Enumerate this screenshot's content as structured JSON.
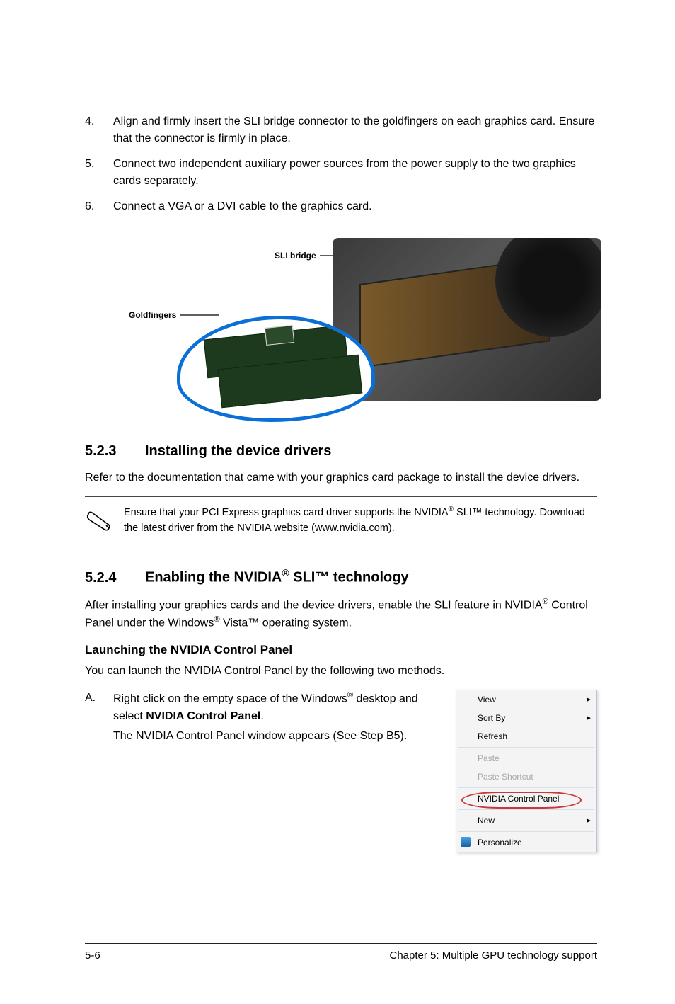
{
  "steps": {
    "s4": {
      "num": "4.",
      "text": "Align and firmly insert the SLI bridge connector to the goldfingers on each graphics card. Ensure that the connector is firmly in place."
    },
    "s5": {
      "num": "5.",
      "text": "Connect two independent auxiliary power sources from the power supply to the two graphics cards separately."
    },
    "s6": {
      "num": "6.",
      "text": "Connect a VGA or a DVI cable to the graphics card."
    }
  },
  "figure": {
    "label_sli": "SLI bridge",
    "label_gold": "Goldfingers"
  },
  "section523": {
    "num": "5.2.3",
    "title": "Installing the device drivers",
    "body": "Refer to the documentation that came with your graphics card package to install the device drivers."
  },
  "note523": {
    "text_a": "Ensure that your PCI Express graphics card driver supports the NVIDIA",
    "text_b": " SLI™ technology. Download the latest driver from the NVIDIA website (www.nvidia.com)."
  },
  "section524": {
    "num": "5.2.4",
    "title_a": "Enabling the NVIDIA",
    "title_b": " SLI™ technology",
    "body_a": "After installing your graphics cards and the device drivers, enable the SLI feature in NVIDIA",
    "body_b": " Control Panel under the Windows",
    "body_c": " Vista™ operating system."
  },
  "launch": {
    "heading": "Launching the NVIDIA Control Panel",
    "intro": "You can launch the NVIDIA Control Panel by the following two methods."
  },
  "methodA": {
    "num": "A.",
    "line1_a": "Right click on the empty space of the Windows",
    "line1_b": " desktop and select ",
    "line1_bold": "NVIDIA Control Panel",
    "line1_c": ".",
    "line2": "The NVIDIA Control Panel window appears (See Step B5)."
  },
  "context_menu": {
    "view": "View",
    "sortby": "Sort By",
    "refresh": "Refresh",
    "paste": "Paste",
    "paste_shortcut": "Paste Shortcut",
    "nvidia": "NVIDIA Control Panel",
    "new": "New",
    "personalize": "Personalize"
  },
  "footer": {
    "page": "5-6",
    "chapter": "Chapter 5: Multiple GPU technology support"
  }
}
